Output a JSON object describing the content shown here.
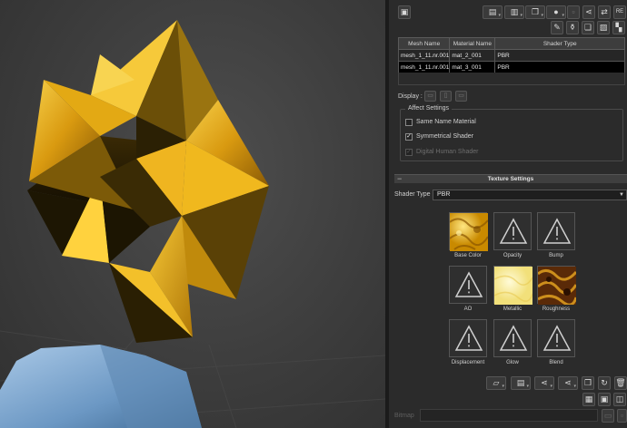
{
  "colors": {
    "panel_bg": "#2b2b2b",
    "selected_row": "#000000",
    "gold": "#e0a80f",
    "viewport_bg": "#3d3d3d"
  },
  "material_table": {
    "headers": [
      "Mesh Name",
      "Material Name",
      "Shader Type"
    ],
    "rows": [
      [
        "mesh_1_11.nr.001",
        "mat_2_001",
        "PBR"
      ],
      [
        "mesh_1_11.nr.001",
        "mat_3_001",
        "PBR"
      ]
    ],
    "selected_row": 1
  },
  "display": {
    "label": "Display :"
  },
  "affect_settings": {
    "title": "Affect Settings",
    "options": [
      {
        "label": "Same Name Material",
        "checked": false,
        "enabled": true
      },
      {
        "label": "Symmetrical Shader",
        "checked": true,
        "enabled": true
      },
      {
        "label": "Digital Human Shader",
        "checked": true,
        "enabled": false
      }
    ]
  },
  "texture_settings": {
    "title": "Texture Settings",
    "shader_type_label": "Shader Type :",
    "shader_type_value": "PBR",
    "slots": [
      {
        "label": "Base Color",
        "image": "gold-texture"
      },
      {
        "label": "Opacity",
        "image": "warning-icon"
      },
      {
        "label": "Bump",
        "image": "warning-icon"
      },
      {
        "label": "AO",
        "image": "warning-icon"
      },
      {
        "label": "Metallic",
        "image": "pale-yellow-texture"
      },
      {
        "label": "Roughness",
        "image": "dark-orange-texture"
      },
      {
        "label": "Displacement",
        "image": "warning-icon"
      },
      {
        "label": "Glow",
        "image": "warning-icon"
      },
      {
        "label": "Blend",
        "image": "warning-icon"
      }
    ]
  },
  "bitmap": {
    "label": "Bitmap"
  },
  "toolbar": {
    "re_label": "RE"
  }
}
